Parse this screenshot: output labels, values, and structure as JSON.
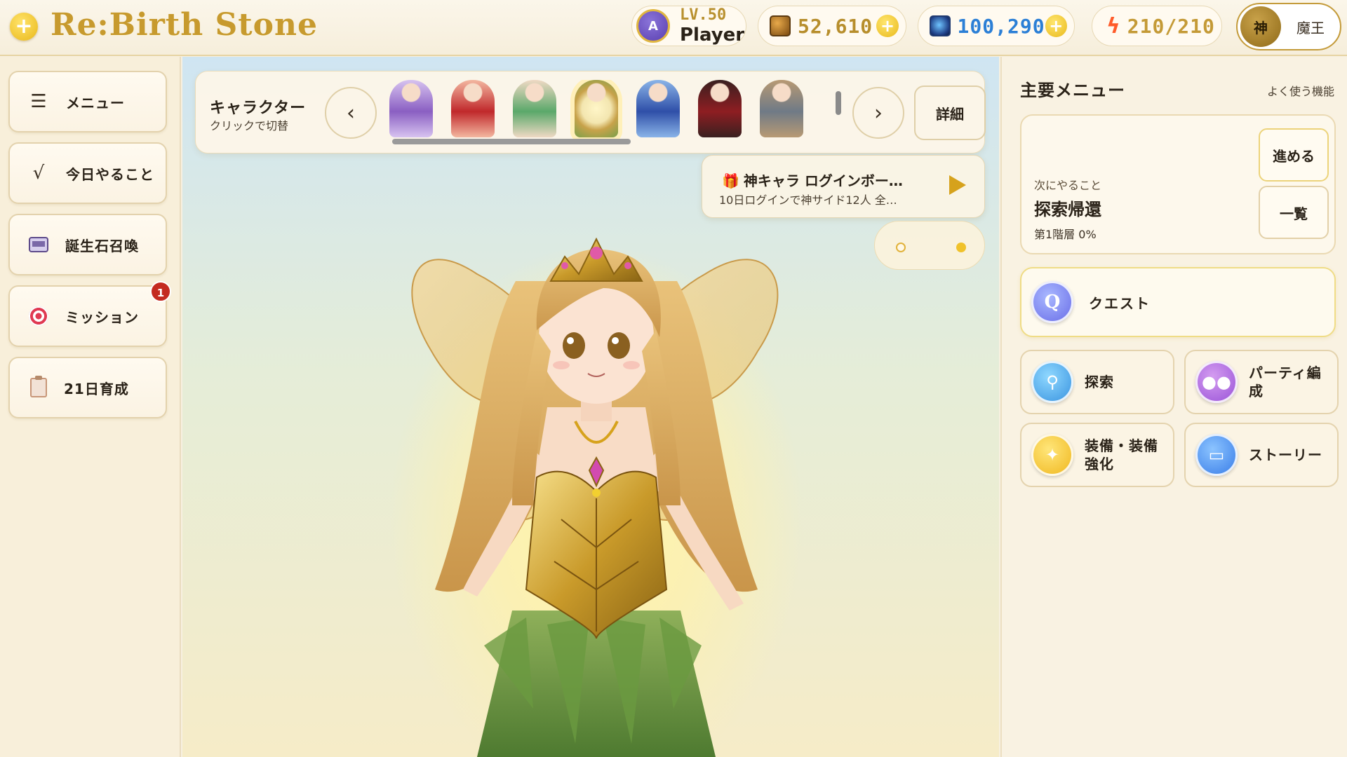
{
  "header": {
    "logo_plus": "+",
    "title": "Re:Birth Stone",
    "avatar_letter": "A",
    "level": "LV.50",
    "player_name": "Player",
    "gold": "52,610",
    "gems": "100,290",
    "energy": "210/210",
    "plus_symbol": "+",
    "mode_god": "神",
    "mode_demon": "魔王"
  },
  "sidebar": {
    "items": [
      {
        "label": "メニュー",
        "icon": "hamburger-icon",
        "glyph": "☰"
      },
      {
        "label": "今日やること",
        "icon": "check-icon",
        "glyph": "√"
      },
      {
        "label": "誕生石召喚",
        "icon": "slot-machine-icon"
      },
      {
        "label": "ミッション",
        "icon": "target-icon",
        "badge": "1"
      },
      {
        "label": "21日育成",
        "icon": "clipboard-icon"
      }
    ]
  },
  "character_bar": {
    "title": "キャラクター",
    "subtitle": "クリックで切替",
    "prev": "‹",
    "next": "›",
    "detail": "詳細",
    "thumbnails": [
      {
        "name": "purple-kimono-character",
        "color": "#8a5fc2",
        "accent": "#d7c3f0"
      },
      {
        "name": "red-dress-character",
        "color": "#c0282b",
        "accent": "#f3b7a0"
      },
      {
        "name": "green-staff-character",
        "color": "#5aa86a",
        "accent": "#efd9c4"
      },
      {
        "name": "fairy-character",
        "color": "#c8a24a",
        "accent": "#7aa04a",
        "selected": true
      },
      {
        "name": "blue-armor-character",
        "color": "#2f4fa8",
        "accent": "#8ab4e8"
      },
      {
        "name": "crimson-cloak-character",
        "color": "#8e1e22",
        "accent": "#3a2020"
      },
      {
        "name": "grey-fox-character",
        "color": "#6f7a86",
        "accent": "#b89a74"
      }
    ]
  },
  "login_banner": {
    "gift": "🎁",
    "title": "神キャラ ログインボー…",
    "subtitle": "10日ログインで神サイド12人 全…"
  },
  "right_panel": {
    "title": "主要メニュー",
    "subtitle": "よく使う機能",
    "next_card": {
      "label": "次にやること",
      "main": "探索帰還",
      "floor": "第1階層 0%",
      "advance": "進める",
      "list": "一覧"
    },
    "quest": {
      "label": "クエスト",
      "glyph": "Q"
    },
    "tiles": [
      {
        "label": "探索",
        "icon": "magnifier-icon"
      },
      {
        "label": "パーティ編成",
        "icon": "party-icon"
      },
      {
        "label": "装備・装備強化",
        "icon": "sparkle-icon"
      },
      {
        "label": "ストーリー",
        "icon": "book-icon"
      }
    ]
  },
  "colors": {
    "gold_accent": "#c79a2e",
    "gem_blue": "#2b7fd6",
    "badge_red": "#c42a20",
    "energy_orange": "#ff5b2a"
  }
}
